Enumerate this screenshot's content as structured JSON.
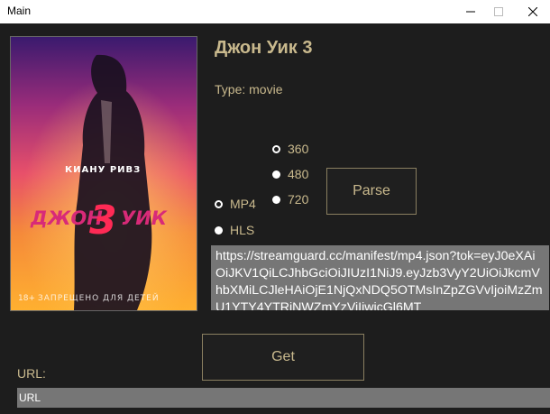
{
  "window": {
    "title": "Main"
  },
  "movie": {
    "title": "Джон Уик 3",
    "type_text": "Type: movie",
    "poster": {
      "actor_text": "КИАНУ РИВЗ",
      "title_left": "ДЖОН",
      "title_number": "3",
      "title_right": "УИК",
      "rating_text": "18+",
      "footer_text": "ЗАПРЕЩЕНО ДЛЯ ДЕТЕЙ"
    }
  },
  "quality_options": [
    {
      "label": "360",
      "checked": true
    },
    {
      "label": "480",
      "checked": false
    },
    {
      "label": "720",
      "checked": false
    }
  ],
  "format_options": [
    {
      "label": "MP4",
      "checked": true
    },
    {
      "label": "HLS",
      "checked": false
    }
  ],
  "buttons": {
    "parse": "Parse",
    "get": "Get"
  },
  "result_url": "https://streamguard.cc/manifest/mp4.json?tok=eyJ0eXAiOiJKV1QiLCJhbGciOiJIUzI1NiJ9.eyJzb3VyY2UiOiJkcmVhbXMiLCJleHAiOjE1NjQxNDQ5OTMsInZpZGVvIjoiMzZmU1YTY4YTRiNWZmYzViIiwicGl6MT",
  "url_field": {
    "label": "URL:",
    "placeholder": "URL",
    "value": ""
  },
  "colors": {
    "background": "#1d1d1d",
    "accent_text": "#c9b98d",
    "field_bg": "#767676",
    "button_border": "#8a7f60"
  }
}
